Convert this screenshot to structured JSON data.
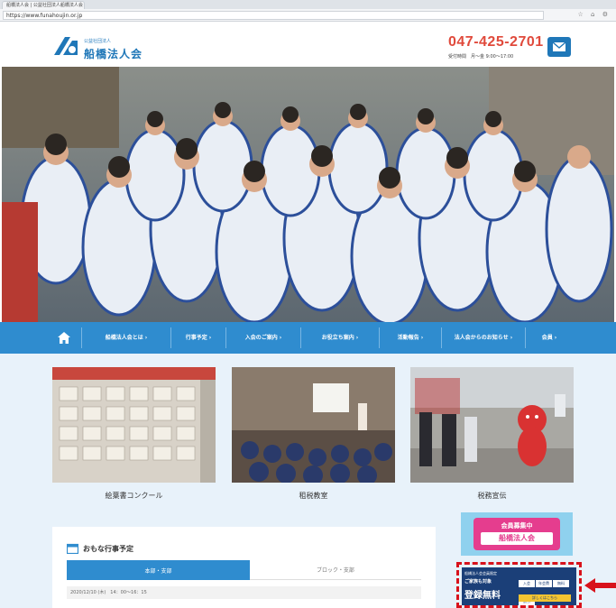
{
  "browser": {
    "tab_title": "船橋法人会 | 公益社団法人船橋法人会",
    "url": "https://www.funahoujin.or.jp",
    "icons": [
      "star-icon",
      "home-icon",
      "settings-icon"
    ]
  },
  "header": {
    "org_sub": "公益社団法人",
    "org_name": "船橋法人会",
    "phone": "047-425-2701",
    "hours": "受付時間　月～金 9:00～17:00",
    "mail_icon": "mail-icon"
  },
  "nav": {
    "home_icon": "home-icon",
    "items": [
      {
        "label": "船橋法人会とは ›"
      },
      {
        "label": "行事予定 ›"
      },
      {
        "label": "入会のご案内 ›"
      },
      {
        "label": "お役立ち案内 ›"
      },
      {
        "label": "活動報告 ›"
      },
      {
        "label": "法人会からのお知らせ ›"
      },
      {
        "label": "会員 ›"
      }
    ]
  },
  "tiles": [
    {
      "caption": "絵葉書コンクール"
    },
    {
      "caption": "租税教室"
    },
    {
      "caption": "税務宣伝"
    }
  ],
  "events": {
    "title": "おもな行事予定",
    "tab_active": "本部・支部",
    "tab_inactive": "ブロック・支部",
    "row": "2020/12/10 (木)　14：00～16：15"
  },
  "banners": {
    "b1_line1": "会員募集中",
    "b1_line2": "船橋法人会",
    "b2_line1": "船橋法人会会員限定",
    "b2_line2": "ご家族も対象",
    "b2_line3": "登録無料",
    "b2_cells": [
      "入会",
      "年会費",
      "無料",
      "割引"
    ],
    "b2_button": "詳しくはこちら"
  },
  "colors": {
    "brand_blue": "#2f8ccf",
    "phone_red": "#e04a3c",
    "highlight_red": "#d8121b",
    "content_bg": "#e8f2fa"
  }
}
